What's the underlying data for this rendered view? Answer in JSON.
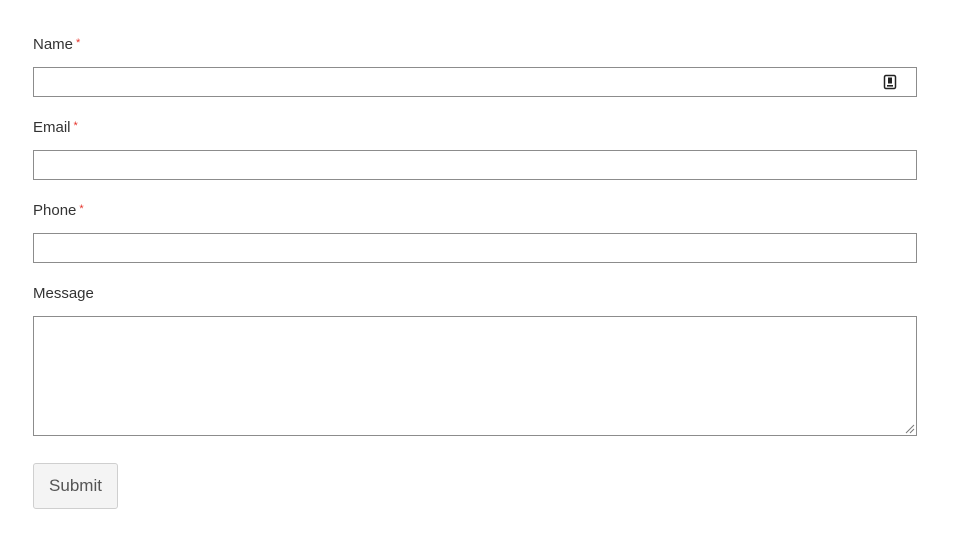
{
  "form": {
    "fields": [
      {
        "label": "Name",
        "required_mark": "*",
        "value": ""
      },
      {
        "label": "Email",
        "required_mark": "*",
        "value": ""
      },
      {
        "label": "Phone",
        "required_mark": "*",
        "value": ""
      },
      {
        "label": "Message",
        "value": ""
      }
    ],
    "submit_label": "Submit",
    "colors": {
      "required": "#e5332a",
      "border": "#8c8c8c",
      "button_bg": "#f4f4f4"
    },
    "icons": [
      "contact-autofill-icon",
      "resize-grip-icon"
    ]
  }
}
